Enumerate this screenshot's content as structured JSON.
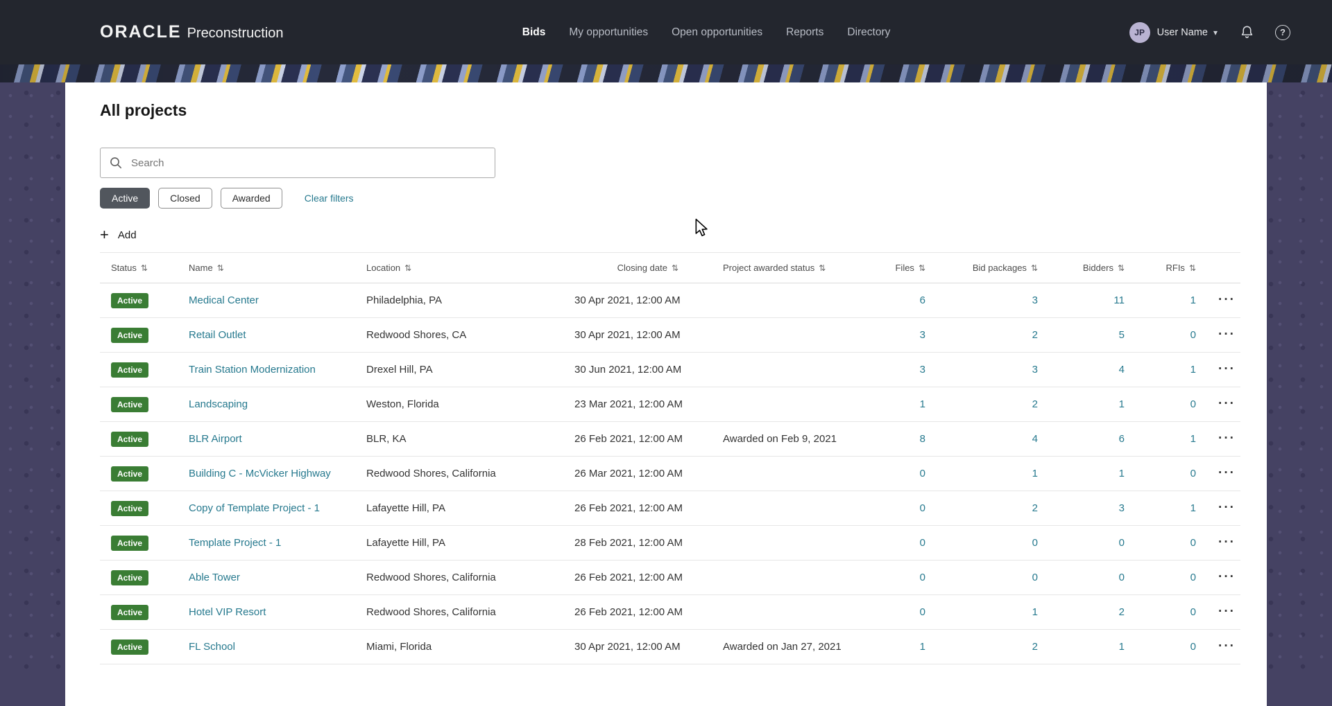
{
  "header": {
    "brand": {
      "logo": "ORACLE",
      "product": "Preconstruction"
    },
    "nav": [
      {
        "label": "Bids",
        "active": true
      },
      {
        "label": "My opportunities",
        "active": false
      },
      {
        "label": "Open opportunities",
        "active": false
      },
      {
        "label": "Reports",
        "active": false
      },
      {
        "label": "Directory",
        "active": false
      }
    ],
    "user": {
      "initials": "JP",
      "name": "User Name"
    }
  },
  "page": {
    "title": "All projects",
    "search_placeholder": "Search",
    "filters": {
      "chips": [
        {
          "label": "Active",
          "selected": true
        },
        {
          "label": "Closed",
          "selected": false
        },
        {
          "label": "Awarded",
          "selected": false
        }
      ],
      "clear_label": "Clear filters"
    },
    "add_label": "Add"
  },
  "icons": {
    "sort": "⇅",
    "ellipsis": "···",
    "plus": "+",
    "chevron_down": "▾",
    "help_q": "?"
  },
  "colors": {
    "header_bg": "#23262e",
    "background_purple": "#454263",
    "badge_green": "#3a7d34",
    "link_teal": "#26798e",
    "chip_selected": "#51565d",
    "strip_yellow": "#e3bd3f",
    "strip_periwinkle": "#8fa0cd"
  },
  "table": {
    "columns": [
      {
        "label": "Status",
        "align": "left"
      },
      {
        "label": "Name",
        "align": "left"
      },
      {
        "label": "Location",
        "align": "left"
      },
      {
        "label": "Closing date",
        "align": "right"
      },
      {
        "label": "Project awarded status",
        "align": "left"
      },
      {
        "label": "Files",
        "align": "right"
      },
      {
        "label": "Bid packages",
        "align": "right"
      },
      {
        "label": "Bidders",
        "align": "right"
      },
      {
        "label": "RFIs",
        "align": "right"
      }
    ],
    "rows": [
      {
        "status": "Active",
        "name": "Medical Center",
        "location": "Philadelphia, PA",
        "closing_date": "30 Apr 2021, 12:00 AM",
        "awarded_status": "",
        "files": 6,
        "bid_packages": 3,
        "bidders": 11,
        "rfis": 1
      },
      {
        "status": "Active",
        "name": "Retail Outlet",
        "location": "Redwood Shores, CA",
        "closing_date": "30 Apr 2021, 12:00 AM",
        "awarded_status": "",
        "files": 3,
        "bid_packages": 2,
        "bidders": 5,
        "rfis": 0
      },
      {
        "status": "Active",
        "name": "Train Station Modernization",
        "location": "Drexel Hill, PA",
        "closing_date": "30 Jun 2021, 12:00 AM",
        "awarded_status": "",
        "files": 3,
        "bid_packages": 3,
        "bidders": 4,
        "rfis": 1
      },
      {
        "status": "Active",
        "name": "Landscaping",
        "location": "Weston, Florida",
        "closing_date": "23 Mar 2021, 12:00 AM",
        "awarded_status": "",
        "files": 1,
        "bid_packages": 2,
        "bidders": 1,
        "rfis": 0
      },
      {
        "status": "Active",
        "name": "BLR Airport",
        "location": "BLR, KA",
        "closing_date": "26 Feb 2021, 12:00 AM",
        "awarded_status": "Awarded on Feb 9, 2021",
        "files": 8,
        "bid_packages": 4,
        "bidders": 6,
        "rfis": 1
      },
      {
        "status": "Active",
        "name": "Building C - McVicker Highway",
        "location": "Redwood Shores, California",
        "closing_date": "26 Mar 2021, 12:00 AM",
        "awarded_status": "",
        "files": 0,
        "bid_packages": 1,
        "bidders": 1,
        "rfis": 0
      },
      {
        "status": "Active",
        "name": "Copy of Template Project - 1",
        "location": "Lafayette Hill, PA",
        "closing_date": "26 Feb 2021, 12:00 AM",
        "awarded_status": "",
        "files": 0,
        "bid_packages": 2,
        "bidders": 3,
        "rfis": 1
      },
      {
        "status": "Active",
        "name": "Template Project - 1",
        "location": "Lafayette Hill, PA",
        "closing_date": "28 Feb 2021, 12:00 AM",
        "awarded_status": "",
        "files": 0,
        "bid_packages": 0,
        "bidders": 0,
        "rfis": 0
      },
      {
        "status": "Active",
        "name": "Able Tower",
        "location": "Redwood Shores, California",
        "closing_date": "26 Feb 2021, 12:00 AM",
        "awarded_status": "",
        "files": 0,
        "bid_packages": 0,
        "bidders": 0,
        "rfis": 0
      },
      {
        "status": "Active",
        "name": "Hotel VIP Resort",
        "location": "Redwood Shores, California",
        "closing_date": "26 Feb 2021, 12:00 AM",
        "awarded_status": "",
        "files": 0,
        "bid_packages": 1,
        "bidders": 2,
        "rfis": 0
      },
      {
        "status": "Active",
        "name": "FL School",
        "location": "Miami, Florida",
        "closing_date": "30 Apr 2021, 12:00 AM",
        "awarded_status": "Awarded on Jan 27, 2021",
        "files": 1,
        "bid_packages": 2,
        "bidders": 1,
        "rfis": 0
      }
    ]
  }
}
